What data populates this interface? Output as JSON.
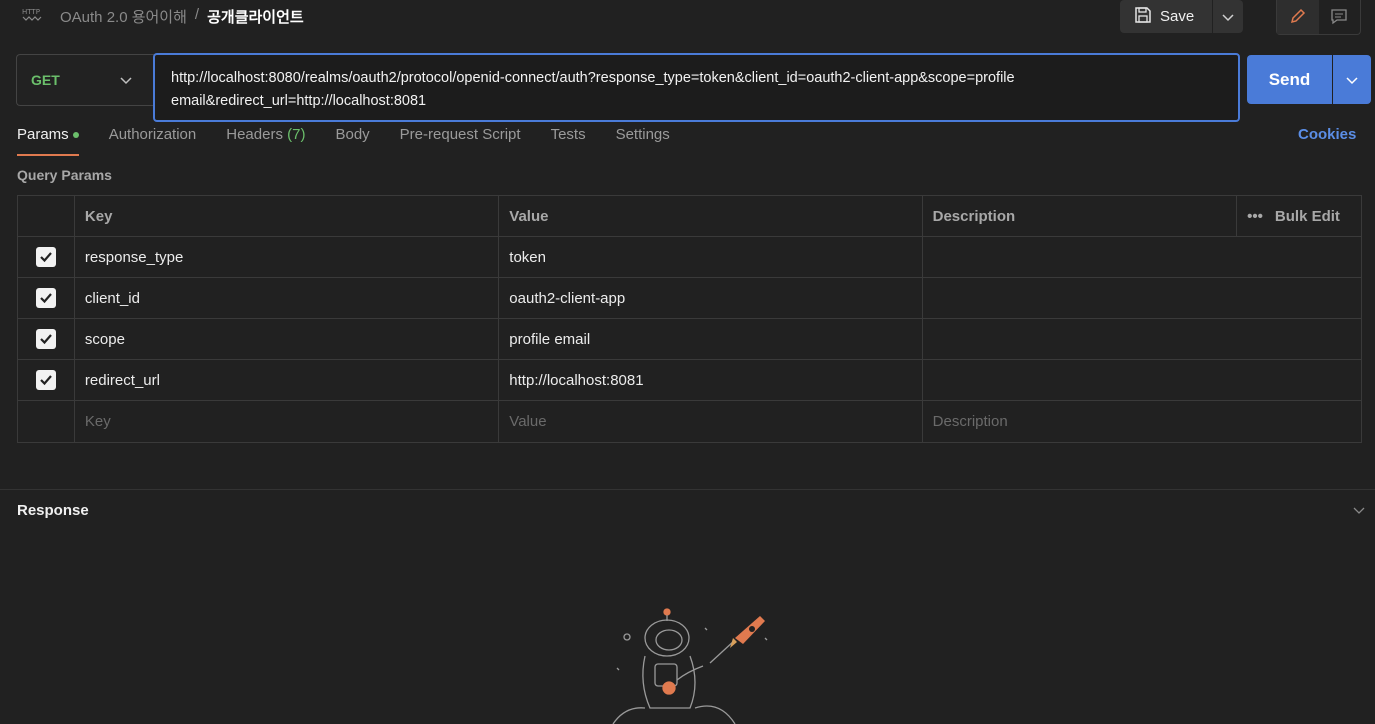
{
  "breadcrumb": {
    "icon_label": "HTTP",
    "parent": "OAuth 2.0 용어이해",
    "separator": "/",
    "current": "공개클라이언트"
  },
  "toolbar": {
    "save_label": "Save"
  },
  "request": {
    "method": "GET",
    "url": "http://localhost:8080/realms/oauth2/protocol/openid-connect/auth?response_type=token&client_id=oauth2-client-app&scope=profile email&redirect_url=http://localhost:8081",
    "send_label": "Send"
  },
  "tabs": [
    {
      "label": "Params",
      "active": true,
      "dot": true
    },
    {
      "label": "Authorization"
    },
    {
      "label": "Headers",
      "count": "(7)"
    },
    {
      "label": "Body"
    },
    {
      "label": "Pre-request Script"
    },
    {
      "label": "Tests"
    },
    {
      "label": "Settings"
    }
  ],
  "cookies_label": "Cookies",
  "query_params": {
    "title": "Query Params",
    "headers": {
      "key": "Key",
      "value": "Value",
      "description": "Description",
      "bulk_edit": "Bulk Edit",
      "more": "•••"
    },
    "rows": [
      {
        "checked": true,
        "key": "response_type",
        "value": "token",
        "description": ""
      },
      {
        "checked": true,
        "key": "client_id",
        "value": "oauth2-client-app",
        "description": ""
      },
      {
        "checked": true,
        "key": "scope",
        "value": "profile email",
        "description": ""
      },
      {
        "checked": true,
        "key": "redirect_url",
        "value": "http://localhost:8081",
        "description": ""
      }
    ],
    "placeholders": {
      "key": "Key",
      "value": "Value",
      "description": "Description"
    }
  },
  "response": {
    "title": "Response"
  },
  "colors": {
    "accent_blue": "#4a7bd8",
    "method_green": "#6bbf6b",
    "tab_underline": "#e07a4f",
    "background": "#212121"
  }
}
